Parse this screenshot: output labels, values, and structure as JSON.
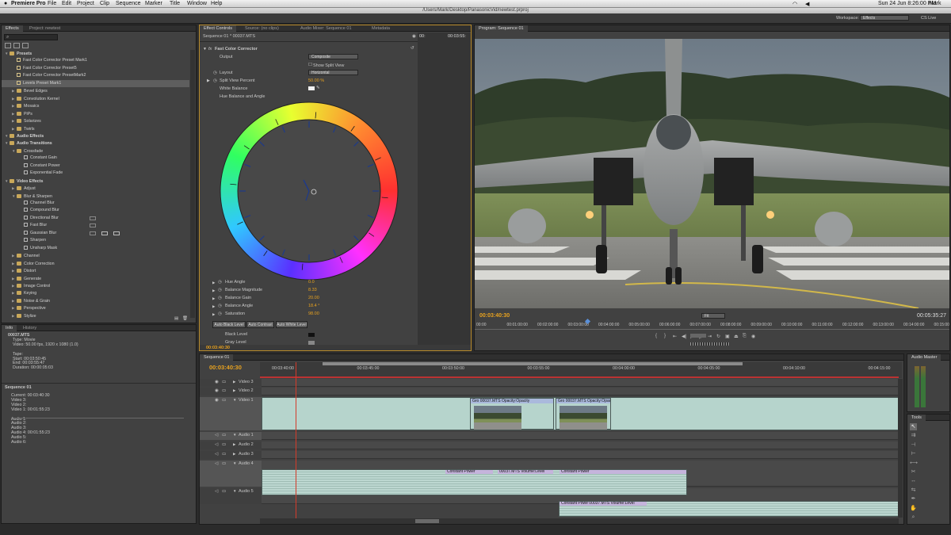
{
  "menubar": {
    "app": "Premiere Pro",
    "items": [
      "File",
      "Edit",
      "Project",
      "Clip",
      "Sequence",
      "Marker",
      "Title",
      "Window",
      "Help"
    ],
    "datetime": "Sun 24 Jun  8:26:00 PM",
    "user": "Mark"
  },
  "window_title": "/Users/Mark/Desktop/PanasonicVid/newtest.prproj",
  "workspace": {
    "label": "Workspace:",
    "value": "Effects",
    "cs_live": "CS Live"
  },
  "effects_panel": {
    "tabs": [
      "Effects",
      "Project: newtest"
    ],
    "rows": [
      {
        "t": "Presets",
        "k": "h",
        "l": 0
      },
      {
        "t": "Fast Color Corrector Preset Mark1",
        "k": "p",
        "l": 1
      },
      {
        "t": "Fast Color Corrector Preset5",
        "k": "p",
        "l": 1
      },
      {
        "t": "Fast Color Corrector PresetMark2",
        "k": "p",
        "l": 1
      },
      {
        "t": "Levels Preset Mark1",
        "k": "p",
        "l": 1,
        "sel": true
      },
      {
        "t": "Bevel Edges",
        "k": "f",
        "l": 1
      },
      {
        "t": "Convolution Kernel",
        "k": "f",
        "l": 1
      },
      {
        "t": "Mosaics",
        "k": "f",
        "l": 1
      },
      {
        "t": "PiPs",
        "k": "f",
        "l": 1
      },
      {
        "t": "Solarizes",
        "k": "f",
        "l": 1
      },
      {
        "t": "Twirls",
        "k": "f",
        "l": 1
      },
      {
        "t": "Audio Effects",
        "k": "h",
        "l": 0
      },
      {
        "t": "Audio Transitions",
        "k": "h",
        "l": 0
      },
      {
        "t": "Crossfade",
        "k": "o",
        "l": 1
      },
      {
        "t": "Constant Gain",
        "k": "e",
        "l": 2
      },
      {
        "t": "Constant Power",
        "k": "e",
        "l": 2
      },
      {
        "t": "Exponential Fade",
        "k": "e",
        "l": 2
      },
      {
        "t": "Video Effects",
        "k": "h",
        "l": 0
      },
      {
        "t": "Adjust",
        "k": "f",
        "l": 1
      },
      {
        "t": "Blur & Sharpen",
        "k": "o",
        "l": 1
      },
      {
        "t": "Channel Blur",
        "k": "e",
        "l": 2
      },
      {
        "t": "Compound Blur",
        "k": "e",
        "l": 2
      },
      {
        "t": "Directional Blur",
        "k": "e",
        "l": 2
      },
      {
        "t": "Fast Blur",
        "k": "e",
        "l": 2
      },
      {
        "t": "Gaussian Blur",
        "k": "e",
        "l": 2
      },
      {
        "t": "Sharpen",
        "k": "e",
        "l": 2
      },
      {
        "t": "Unsharp Mask",
        "k": "e",
        "l": 2
      },
      {
        "t": "Channel",
        "k": "f",
        "l": 1
      },
      {
        "t": "Color Correction",
        "k": "f",
        "l": 1
      },
      {
        "t": "Distort",
        "k": "f",
        "l": 1
      },
      {
        "t": "Generate",
        "k": "f",
        "l": 1
      },
      {
        "t": "Image Control",
        "k": "f",
        "l": 1
      },
      {
        "t": "Keying",
        "k": "f",
        "l": 1
      },
      {
        "t": "Noise & Grain",
        "k": "f",
        "l": 1
      },
      {
        "t": "Perspective",
        "k": "f",
        "l": 1
      },
      {
        "t": "Stylize",
        "k": "f",
        "l": 1
      }
    ]
  },
  "info_panel": {
    "tabs": [
      "Info",
      "History"
    ],
    "lines": [
      "00037.MTS",
      "Type: Movie",
      "Video: 50.00 fps, 1920 x 1080 (1.0)",
      "",
      "Tape:",
      "Start: 00:03:50:45",
      "End: 00:03:55:47",
      "Duration: 00:00:05:03"
    ],
    "seq_title": "Sequence 01",
    "seq_lines": [
      "Current: 00:03:40:30",
      "Video 3:",
      "Video 2:",
      "Video 1: 00:01:55:23",
      "",
      "Audio 1:",
      "Audio 2:",
      "Audio 3:",
      "Audio 4: 00:01:55:23",
      "Audio 5:",
      "Audio 6:"
    ]
  },
  "effect_controls": {
    "tabs": [
      "Effect Controls",
      "Source: (no clips)",
      "Audio Mixer: Sequence 01",
      "Metadata"
    ],
    "header": "Sequence 01 * 00037.MTS",
    "ruler_start": "00:",
    "ruler_end": "00:03:55:",
    "effect_name": "Fast Color Corrector",
    "output_label": "Output",
    "output_value": "Composite",
    "split_view": "Show Split View",
    "layout_label": "Layout",
    "layout_value": "Horizontal",
    "split_pct_label": "Split View Percent",
    "split_pct_value": "50.00 %",
    "white_balance": "White Balance",
    "hue_balance": "Hue Balance and Angle",
    "params": [
      {
        "label": "Hue Angle",
        "value": "0.0"
      },
      {
        "label": "Balance Magnitude",
        "value": "8.33"
      },
      {
        "label": "Balance Gain",
        "value": "20.00"
      },
      {
        "label": "Balance Angle",
        "value": "18.4 °"
      },
      {
        "label": "Saturation",
        "value": "98.00"
      }
    ],
    "auto_buttons": [
      "Auto Black Level",
      "Auto Contrast",
      "Auto White Level"
    ],
    "black_level": "Black Level",
    "gray_level": "Gray Level",
    "timecode": "00:03:40:30"
  },
  "program_monitor": {
    "tab": "Program: Sequence 01",
    "timecode": "00:03:40:30",
    "fit": "Fit",
    "duration": "00:05:35:27",
    "ruler": [
      "00:00",
      "00:01:00:00",
      "00:02:00:00",
      "00:03:00:00",
      "00:04:00:00",
      "00:05:00:00",
      "00:06:00:00",
      "00:07:00:00",
      "00:08:00:00",
      "00:09:00:00",
      "00:10:00:00",
      "00:11:00:00",
      "00:12:00:00",
      "00:13:00:00",
      "00:14:00:00",
      "00:15:00:00"
    ]
  },
  "timeline": {
    "tab": "Sequence 01",
    "timecode": "00:03:40:30",
    "ruler": [
      "00:03:40:00",
      "00:03:45:00",
      "00:03:50:00",
      "00:03:55:00",
      "00:04:00:00",
      "00:04:05:00",
      "00:04:10:00",
      "00:04:15:00"
    ],
    "tracks": [
      "Video 3",
      "Video 2",
      "Video 1",
      "Audio 1",
      "Audio 2",
      "Audio 3",
      "Audio 4",
      "Audio 5"
    ],
    "video_clips": [
      "Gro 00037.MTS  Opacity:Opacity",
      "Gro 00037.MTS  Opacity:Opacity"
    ],
    "audio_clips": [
      "Constant Power",
      "00037.MTS  Volume:Level",
      "Constant Power",
      "Constant Powe 00037.MTS  Volume:Level"
    ]
  },
  "audio_master": {
    "tab": "Audio Master"
  },
  "tools": {
    "tab": "Tools"
  },
  "colors": {
    "accent": "#e8a21f",
    "panel": "#414141",
    "clip_video": "#b6d4cc",
    "clip_audio": "#bcd7d0",
    "playhead": "#d43b2a"
  }
}
